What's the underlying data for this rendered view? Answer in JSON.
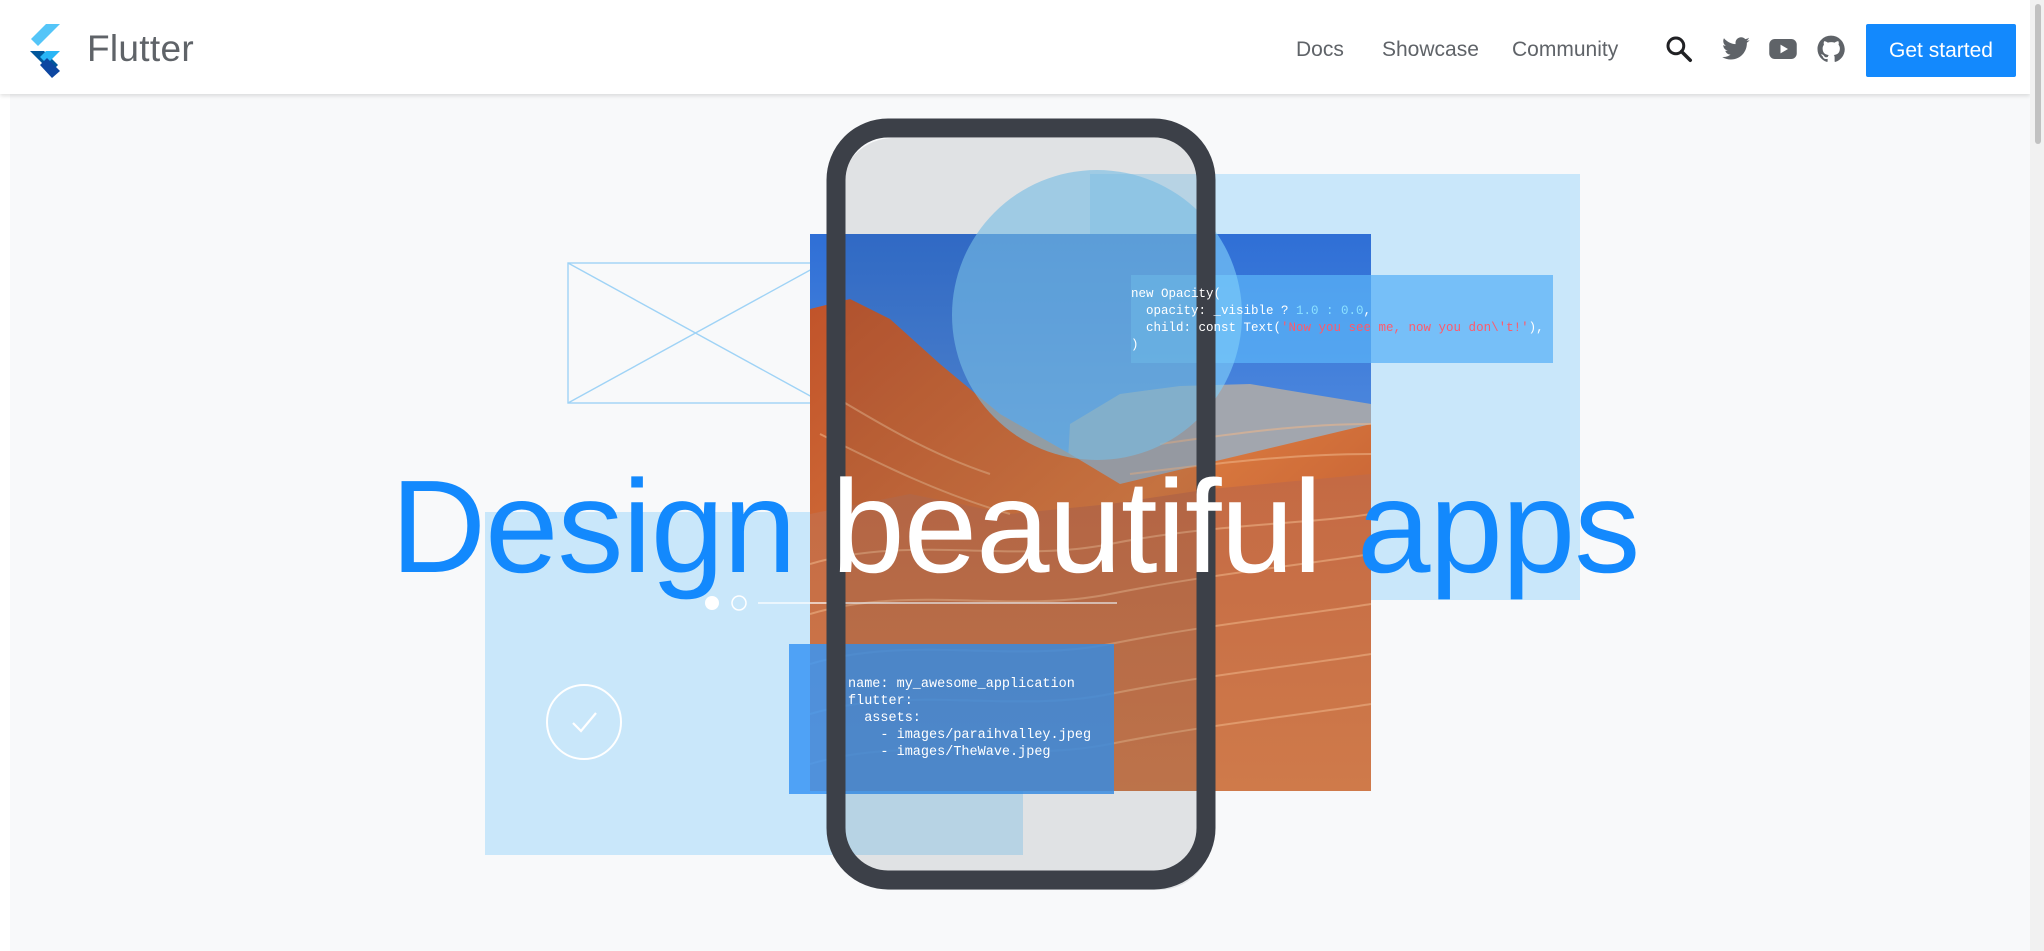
{
  "header": {
    "brand": "Flutter",
    "nav": [
      "Docs",
      "Showcase",
      "Community"
    ],
    "icons": [
      "search-icon",
      "twitter-icon",
      "youtube-icon",
      "github-icon"
    ],
    "cta": "Get started"
  },
  "hero": {
    "headline": [
      "Design",
      "beautiful",
      "apps"
    ],
    "yaml": [
      "name: my_awesome_application",
      "flutter:",
      "  assets:",
      "    - images/paraihvalley.jpeg",
      "    - images/TheWave.jpeg"
    ],
    "dart": {
      "line1": "new Opacity(",
      "line2_a": "  opacity: _visible ? ",
      "line2_b": "1.0 : 0.0",
      "line2_c": ",",
      "line3_a": "  child: const Text(",
      "line3_b": "'Now you see me, now you don\\'t!'",
      "line3_c": "),",
      "line4": ")"
    }
  },
  "colors": {
    "accent": "#1389fd",
    "light_blue": "#c9e7fa",
    "phone_frame": "#3c4048",
    "background": "#f8f9fa"
  }
}
